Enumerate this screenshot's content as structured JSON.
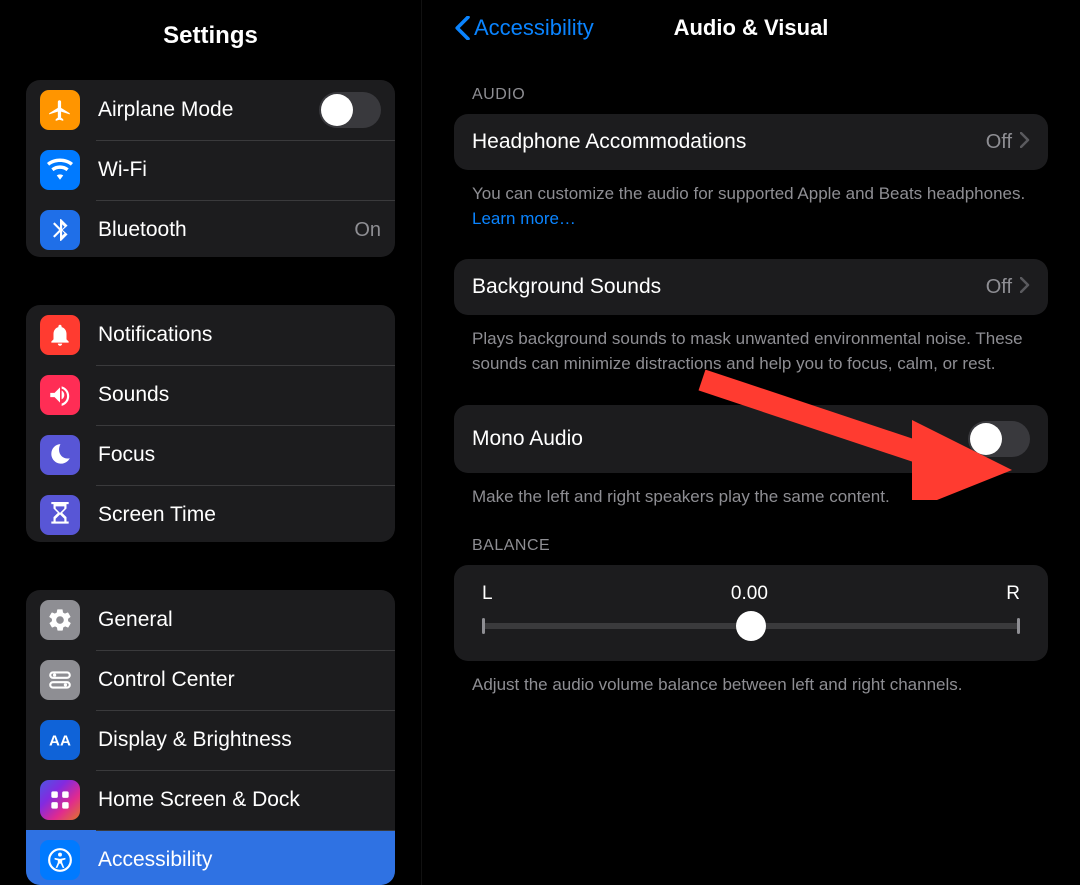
{
  "left": {
    "title": "Settings",
    "groups": [
      {
        "items": [
          {
            "key": "airplane",
            "label": "Airplane Mode",
            "icon": "airplane-icon",
            "hasSwitch": true
          },
          {
            "key": "wifi",
            "label": "Wi-Fi",
            "icon": "wifi-icon"
          },
          {
            "key": "bluetooth",
            "label": "Bluetooth",
            "icon": "bluetooth-icon",
            "value": "On"
          }
        ]
      },
      {
        "items": [
          {
            "key": "notifications",
            "label": "Notifications",
            "icon": "bell-icon"
          },
          {
            "key": "sounds",
            "label": "Sounds",
            "icon": "speaker-icon"
          },
          {
            "key": "focus",
            "label": "Focus",
            "icon": "moon-icon"
          },
          {
            "key": "screentime",
            "label": "Screen Time",
            "icon": "hourglass-icon"
          }
        ]
      },
      {
        "items": [
          {
            "key": "general",
            "label": "General",
            "icon": "gear-icon"
          },
          {
            "key": "controlcenter",
            "label": "Control Center",
            "icon": "switches-icon"
          },
          {
            "key": "display",
            "label": "Display & Brightness",
            "icon": "aa-icon"
          },
          {
            "key": "homescreen",
            "label": "Home Screen & Dock",
            "icon": "apps-icon"
          },
          {
            "key": "accessibility",
            "label": "Accessibility",
            "icon": "accessibility-icon",
            "selected": true
          }
        ]
      }
    ]
  },
  "right": {
    "back_label": "Accessibility",
    "title": "Audio & Visual",
    "audio_header": "AUDIO",
    "headphone": {
      "label": "Headphone Accommodations",
      "value": "Off"
    },
    "headphone_footer": "You can customize the audio for supported Apple and Beats headphones. ",
    "headphone_link": "Learn more…",
    "background": {
      "label": "Background Sounds",
      "value": "Off"
    },
    "background_footer": "Plays background sounds to mask unwanted environmental noise. These sounds can minimize distractions and help you to focus, calm, or rest.",
    "mono": {
      "label": "Mono Audio"
    },
    "mono_footer": "Make the left and right speakers play the same content.",
    "balance_header": "BALANCE",
    "balance": {
      "left": "L",
      "center": "0.00",
      "right": "R"
    },
    "balance_footer": "Adjust the audio volume balance between left and right channels."
  }
}
